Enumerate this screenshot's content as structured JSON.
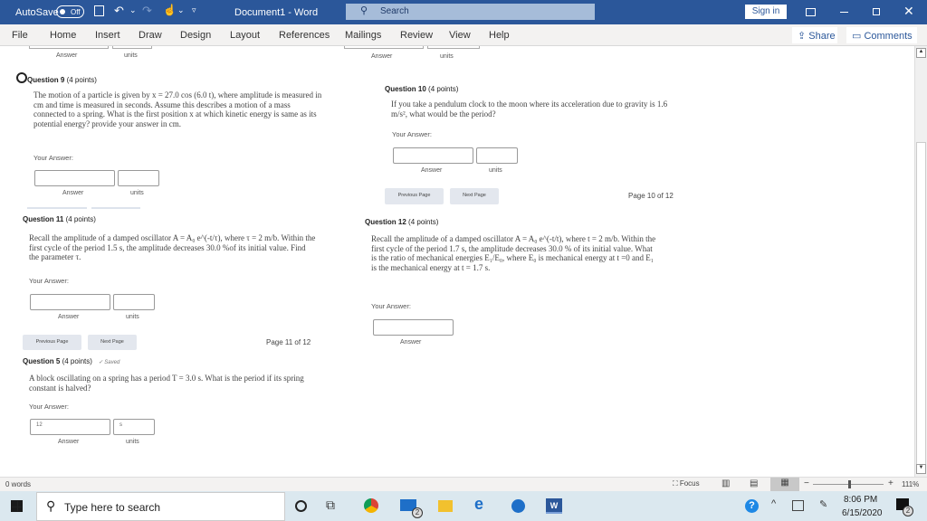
{
  "titlebar": {
    "autosave": "AutoSave",
    "autosave_state": "Off",
    "doc_title": "Document1  -  Word",
    "search": "Search",
    "sign_in": "Sign in"
  },
  "ribbon": {
    "tabs": [
      "File",
      "Home",
      "Insert",
      "Draw",
      "Design",
      "Layout",
      "References",
      "Mailings",
      "Review",
      "View",
      "Help"
    ],
    "share": "Share",
    "comments": "Comments"
  },
  "doc": {
    "top_labels": {
      "answer": "Answer",
      "units": "units"
    },
    "q9": {
      "title": "Question 9",
      "points": "(4 points)",
      "text": "The motion of a particle is given by x = 27.0 cos (6.0 t), where amplitude is measured in cm and time is measured in seconds. Assume this describes a motion of a mass connected to a spring. What is the first position x at which kinetic energy is same as its potential energy? provide your answer in cm.",
      "your_answer": "Your Answer:",
      "answer": "Answer",
      "units": "units"
    },
    "q10": {
      "title": "Question 10",
      "points": "(4 points)",
      "text": "If you take a pendulum clock to the moon where its acceleration due to gravity is 1.6 m/s², what would be the period?",
      "your_answer": "Your Answer:",
      "answer": "Answer",
      "units": "units",
      "prev": "Previous Page",
      "next": "Next Page",
      "page": "Page 10 of 12"
    },
    "q11": {
      "title": "Question 11",
      "points": "(4 points)",
      "text": "Recall the amplitude of a damped oscillator A = A₀ e^(-t/τ), where τ = 2 m/b. Within the first cycle of the period 1.5 s, the amplitude decreases 30.0 %of its initial value. Find the parameter τ.",
      "your_answer": "Your Answer:",
      "answer": "Answer",
      "units": "units",
      "prev": "Previous Page",
      "next": "Next Page",
      "page": "Page 11 of 12"
    },
    "q12": {
      "title": "Question 12",
      "points": "(4 points)",
      "text": "Recall the amplitude of a damped oscillator A = A₀ e^(-t/t), where t = 2 m/b. Within the first cycle of the period 1.7 s, the amplitude decreases 30.0 % of its initial value. What is the ratio of  mechanical energies E₁/E₀, where E₀ is mechanical energy at t =0 and E₁ is the mechanical energy at t = 1.7 s.",
      "your_answer": "Your Answer:",
      "answer": "Answer"
    },
    "q5": {
      "title": "Question 5",
      "points": "(4 points)",
      "saved": "✓ Saved",
      "text": "A block oscillating on a spring has a period T = 3.0 s. What is the period if its spring constant is halved?",
      "your_answer": "Your Answer:",
      "answer_value": "12",
      "units_value": "s",
      "answer": "Answer",
      "units": "units"
    }
  },
  "status": {
    "words": "0 words",
    "focus": "Focus",
    "zoom": "111%",
    "zoom_percent": 111
  },
  "taskbar": {
    "search": "Type here to search",
    "time": "8:06 PM",
    "date": "6/15/2020",
    "notifications": "2",
    "mail_badge": "2"
  },
  "colors": {
    "word_blue": "#2b579a",
    "ribbon": "#f3f2f1"
  }
}
